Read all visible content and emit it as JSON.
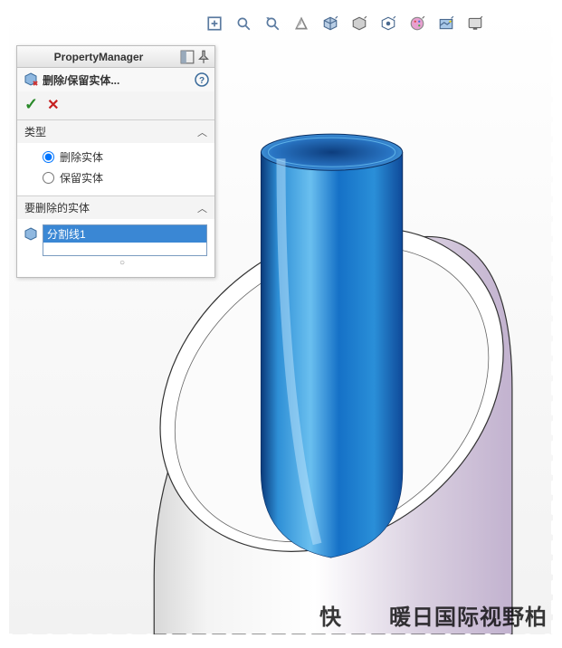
{
  "panel": {
    "title": "PropertyManager",
    "feature_name": "删除/保留实体...",
    "section_type_title": "类型",
    "radio_delete": "删除实体",
    "radio_keep": "保留实体",
    "section_bodies_title": "要删除的实体",
    "selected_item": "分割线1"
  },
  "watermark": {
    "part1": "快",
    "part2": "暖日国际视野柏"
  }
}
